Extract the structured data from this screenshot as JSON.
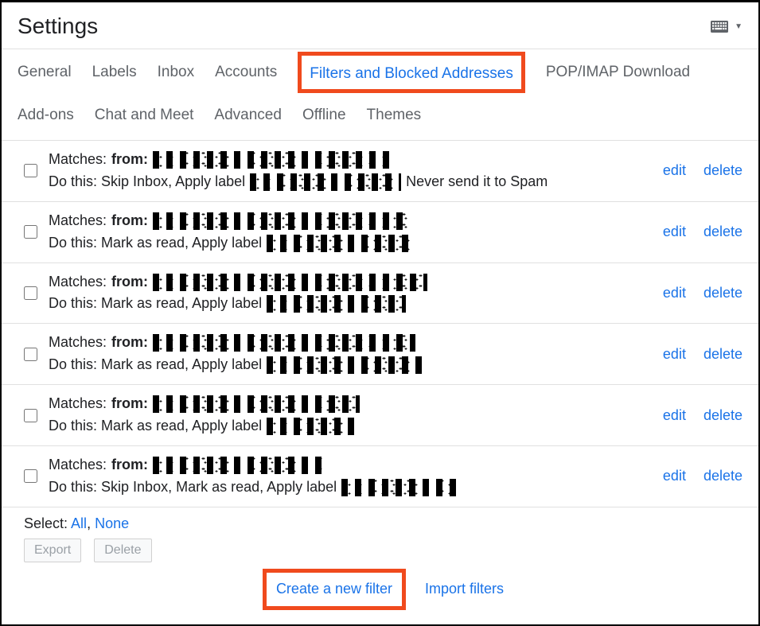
{
  "header": {
    "title": "Settings"
  },
  "tabs": {
    "general": "General",
    "labels": "Labels",
    "inbox": "Inbox",
    "accounts": "Accounts",
    "filters": "Filters and Blocked Addresses",
    "pop_imap": "POP/IMAP Download",
    "addons": "Add-ons",
    "chat": "Chat and Meet",
    "advanced": "Advanced",
    "offline": "Offline",
    "themes": "Themes"
  },
  "labels": {
    "matches": "Matches:",
    "from": "from:",
    "do_this": "Do this:",
    "edit": "edit",
    "delete_link": "delete",
    "select": "Select:",
    "all": "All",
    "none": "None",
    "comma": ",",
    "export": "Export",
    "delete_btn": "Delete",
    "create_filter": "Create a new filter",
    "import_filters": "Import filters"
  },
  "filters": [
    {
      "action_prefix": "Skip Inbox, Apply label",
      "action_suffix": "Never send it to Spam",
      "r1": 300,
      "r2": 190
    },
    {
      "action_prefix": "Mark as read, Apply label",
      "action_suffix": "",
      "r1": 320,
      "r2": 185
    },
    {
      "action_prefix": "Mark as read, Apply label",
      "action_suffix": "",
      "r1": 345,
      "r2": 175
    },
    {
      "action_prefix": "Mark as read, Apply label",
      "action_suffix": "",
      "r1": 330,
      "r2": 195
    },
    {
      "action_prefix": "Mark as read, Apply label",
      "action_suffix": "",
      "r1": 260,
      "r2": 110
    },
    {
      "action_prefix": "Skip Inbox, Mark as read, Apply label",
      "action_suffix": "",
      "r1": 215,
      "r2": 145
    }
  ]
}
